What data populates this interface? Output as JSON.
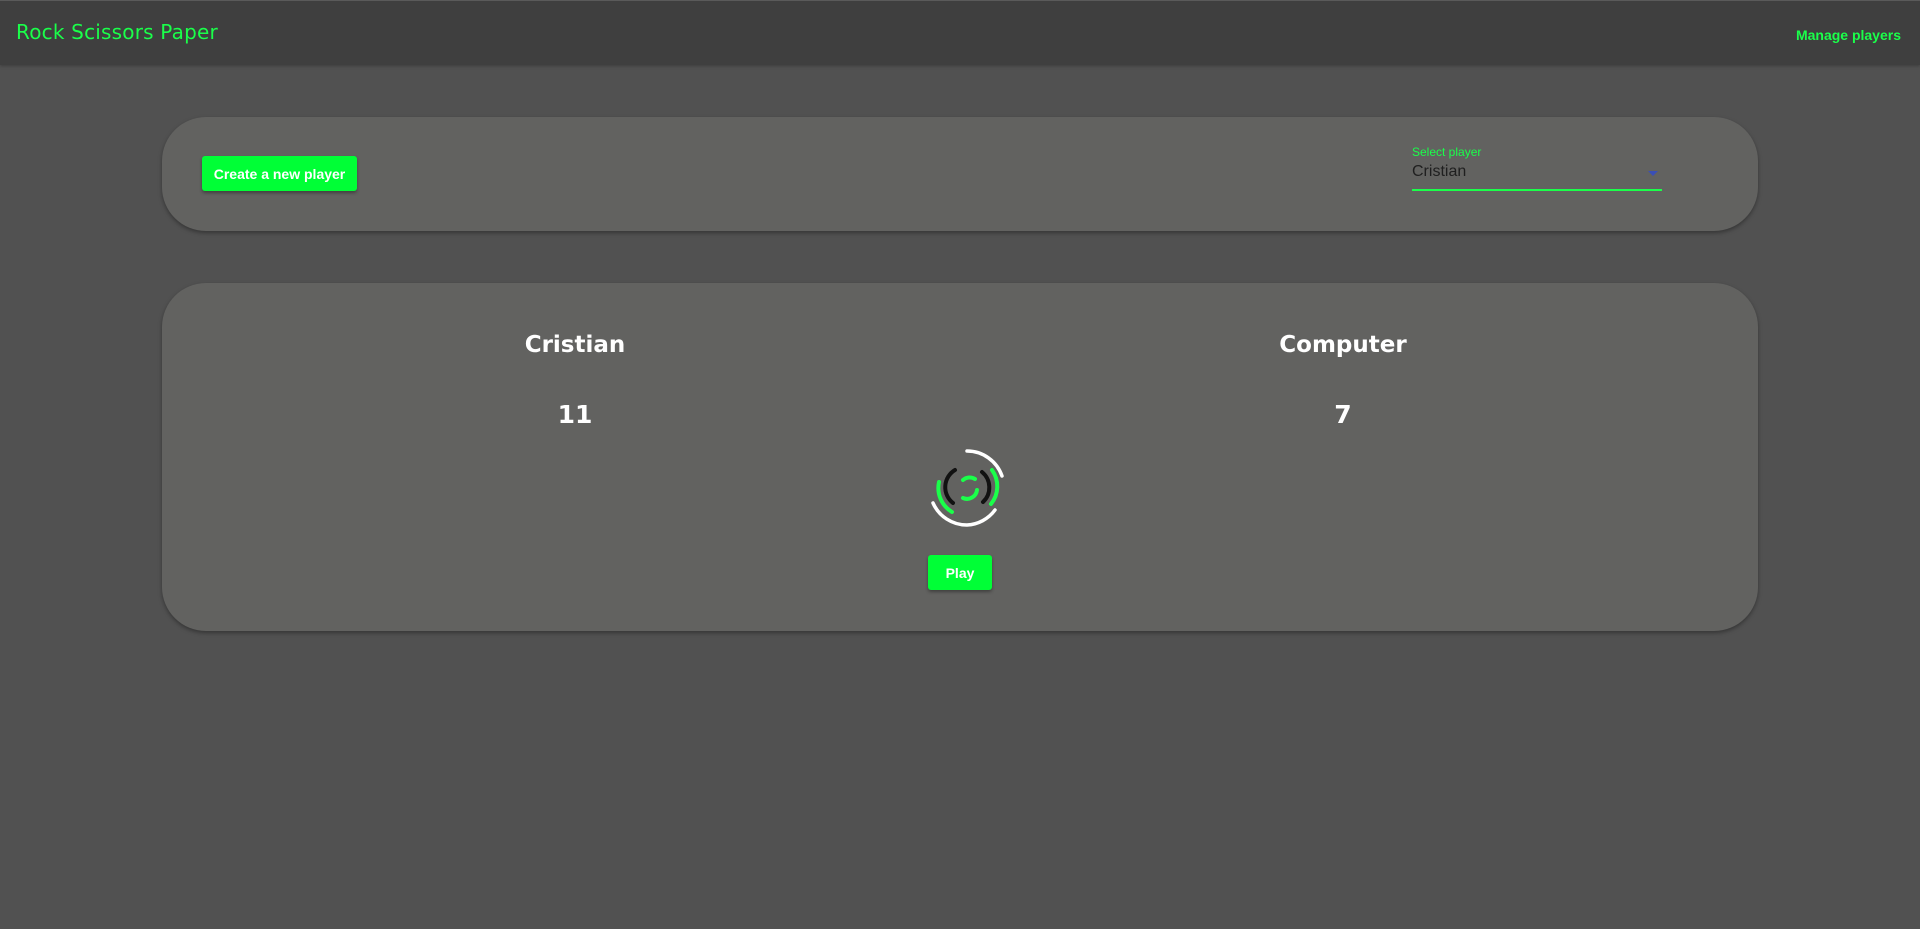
{
  "header": {
    "title": "Rock Scissors Paper",
    "manage_link": "Manage players"
  },
  "controls": {
    "create_button": "Create a new player",
    "select_label": "Select player",
    "selected_player": "Cristian"
  },
  "game": {
    "player": {
      "name": "Cristian",
      "score": "11"
    },
    "opponent": {
      "name": "Computer",
      "score": "7"
    },
    "play_button": "Play"
  },
  "colors": {
    "accent": "#1aff4a",
    "button": "#00ff36",
    "background": "#515151",
    "appbar": "#3f3f3f",
    "card": "#626260"
  },
  "icons": {
    "spinner": "loading-spinner-icon",
    "select_arrow": "caret-down-icon"
  }
}
